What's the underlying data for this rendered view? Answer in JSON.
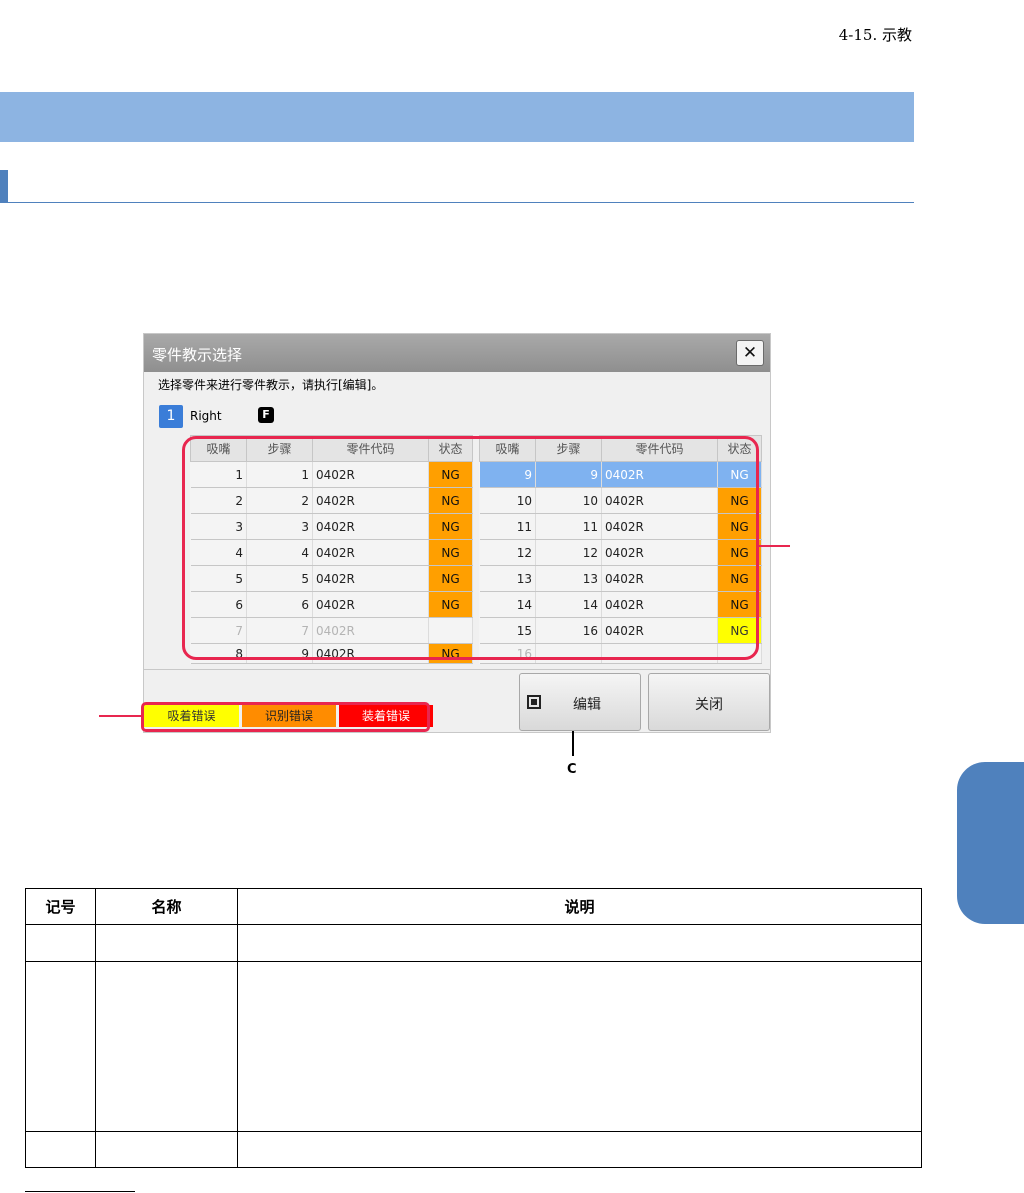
{
  "header": {
    "section_ref": "4-15. 示教"
  },
  "dialog": {
    "title": "零件教示选择",
    "instruction": "选择零件来进行零件教示，请执行[编辑]。",
    "head_number": "1",
    "head_name": "Right",
    "head_flag": "F",
    "columns": [
      "吸嘴",
      "步骤",
      "零件代码",
      "状态"
    ],
    "left_rows": [
      {
        "nozzle": "1",
        "step": "1",
        "code": "0402R",
        "status": "NG",
        "color": "orange"
      },
      {
        "nozzle": "2",
        "step": "2",
        "code": "0402R",
        "status": "NG",
        "color": "orange"
      },
      {
        "nozzle": "3",
        "step": "3",
        "code": "0402R",
        "status": "NG",
        "color": "orange"
      },
      {
        "nozzle": "4",
        "step": "4",
        "code": "0402R",
        "status": "NG",
        "color": "orange"
      },
      {
        "nozzle": "5",
        "step": "5",
        "code": "0402R",
        "status": "NG",
        "color": "orange"
      },
      {
        "nozzle": "6",
        "step": "6",
        "code": "0402R",
        "status": "NG",
        "color": "orange"
      },
      {
        "nozzle": "7",
        "step": "7",
        "code": "0402R",
        "status": "",
        "color": "none",
        "dim": true
      },
      {
        "nozzle": "8",
        "step": "9",
        "code": "0402R",
        "status": "NG",
        "color": "orange",
        "cut": true
      }
    ],
    "right_rows": [
      {
        "nozzle": "9",
        "step": "9",
        "code": "0402R",
        "status": "NG",
        "color": "selected",
        "selected": true
      },
      {
        "nozzle": "10",
        "step": "10",
        "code": "0402R",
        "status": "NG",
        "color": "orange"
      },
      {
        "nozzle": "11",
        "step": "11",
        "code": "0402R",
        "status": "NG",
        "color": "orange"
      },
      {
        "nozzle": "12",
        "step": "12",
        "code": "0402R",
        "status": "NG",
        "color": "orange"
      },
      {
        "nozzle": "13",
        "step": "13",
        "code": "0402R",
        "status": "NG",
        "color": "orange"
      },
      {
        "nozzle": "14",
        "step": "14",
        "code": "0402R",
        "status": "NG",
        "color": "orange"
      },
      {
        "nozzle": "15",
        "step": "16",
        "code": "0402R",
        "status": "NG",
        "color": "yellow"
      },
      {
        "nozzle": "16",
        "step": "",
        "code": "",
        "status": "",
        "color": "none",
        "dim": true,
        "cut": true
      }
    ],
    "legend": [
      "吸着错误",
      "识别错误",
      "装着错误"
    ],
    "legend_colors": [
      "#ffff00",
      "#ff8c00",
      "#ff0000"
    ],
    "edit_button": "编辑",
    "close_button": "关闭"
  },
  "callouts": {
    "c_label": "C"
  },
  "desc_table": {
    "headers": [
      "记号",
      "名称",
      "说明"
    ]
  },
  "colors": {
    "section_bar": "#8db4e2",
    "accent": "#4f81bd",
    "callout": "#e8264f",
    "ng_orange": "#ff9f00",
    "ng_yellow": "#ffff00",
    "selected": "#7fb2f0"
  }
}
